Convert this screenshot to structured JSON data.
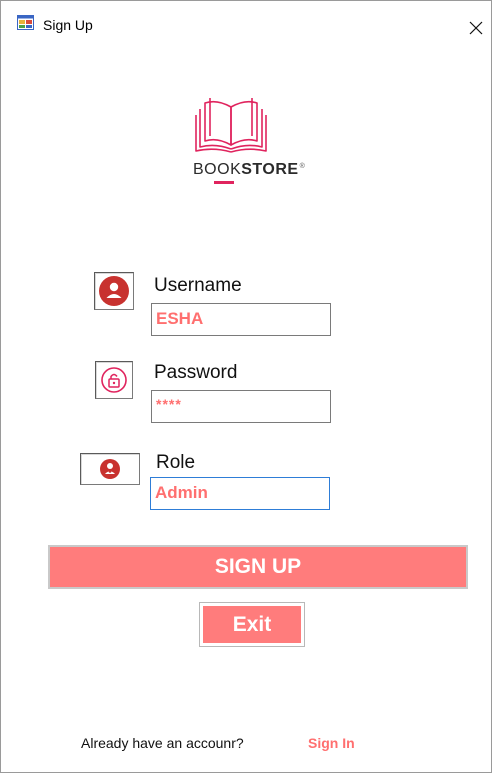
{
  "window": {
    "title": "Sign Up",
    "close_symbol": "✕"
  },
  "logo": {
    "word_regular": "BOOK",
    "word_bold": "STORE",
    "mark": "®"
  },
  "fields": {
    "username": {
      "label": "Username",
      "value": "ESHA",
      "icon": "user-icon"
    },
    "password": {
      "label": "Password",
      "value": "****",
      "icon": "lock-icon"
    },
    "role": {
      "label": "Role",
      "value": "Admin",
      "icon": "role-icon"
    }
  },
  "buttons": {
    "signup": "SIGN UP",
    "exit": "Exit"
  },
  "footer": {
    "prompt": "Already have an accounr?",
    "signin": "Sign In"
  },
  "colors": {
    "accent": "#ff7c7c",
    "accent_text": "#ff6f6f",
    "brand_red": "#e0245e"
  }
}
